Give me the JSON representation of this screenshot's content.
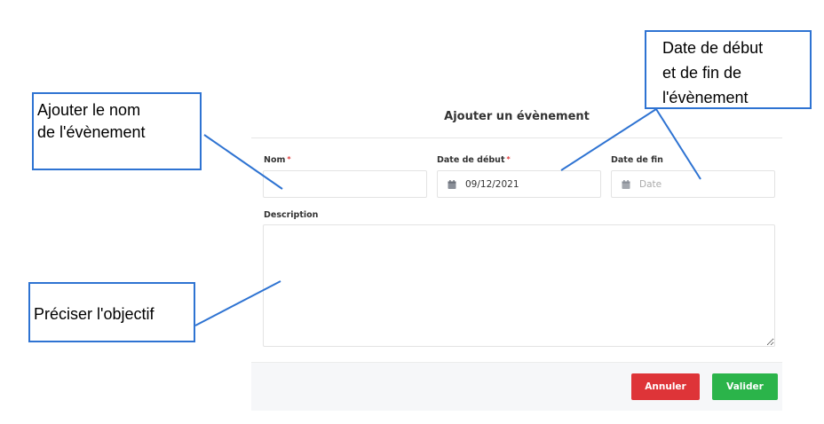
{
  "modal": {
    "title": "Ajouter un évènement",
    "fields": {
      "name": {
        "label": "Nom",
        "required_mark": "*",
        "value": ""
      },
      "start_date": {
        "label": "Date de début",
        "required_mark": "*",
        "value": "09/12/2021",
        "icon": "calendar-icon"
      },
      "end_date": {
        "label": "Date de fin",
        "placeholder": "Date",
        "icon": "calendar-icon"
      },
      "description": {
        "label": "Description",
        "value": ""
      }
    },
    "buttons": {
      "cancel": "Annuler",
      "validate": "Valider"
    }
  },
  "annotations": {
    "name": [
      "Ajouter le nom",
      "de l'évènement"
    ],
    "dates": [
      "Date de début",
      "et de fin de",
      "l'évènement"
    ],
    "objective": "Préciser l'objectif"
  },
  "colors": {
    "callout_border": "#2e73d2",
    "cancel_button": "#de3438",
    "validate_button": "#2bb44a",
    "required_mark": "#e23a3a"
  }
}
